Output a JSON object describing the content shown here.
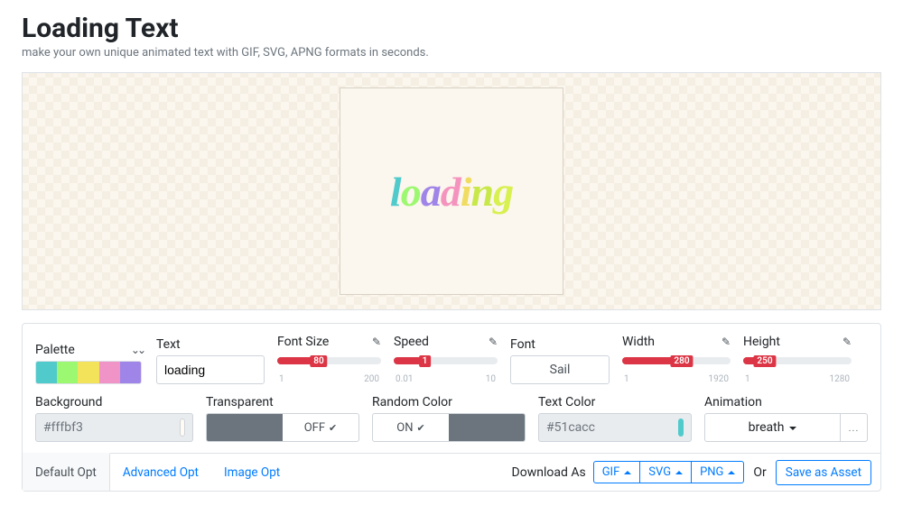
{
  "header": {
    "title": "Loading Text",
    "subtitle": "make your own unique animated text with GIF, SVG, APNG formats in seconds."
  },
  "preview": {
    "text": "loading"
  },
  "palette": {
    "label": "Palette",
    "colors": [
      "#51cacc",
      "#9df871",
      "#f2e35b",
      "#f093c6",
      "#a085e8"
    ]
  },
  "text_field": {
    "label": "Text",
    "value": "loading"
  },
  "font_size": {
    "label": "Font Size",
    "min": "1",
    "max": "200",
    "value": "80",
    "fill_pct": 40
  },
  "speed": {
    "label": "Speed",
    "min": "0.01",
    "max": "10",
    "value": "1",
    "fill_pct": 30
  },
  "font": {
    "label": "Font",
    "value": "Sail"
  },
  "width": {
    "label": "Width",
    "min": "1",
    "max": "1920",
    "value": "280",
    "fill_pct": 55
  },
  "height": {
    "label": "Height",
    "min": "1",
    "max": "1280",
    "value": "250",
    "fill_pct": 20
  },
  "background": {
    "label": "Background",
    "value": "#fffbf3"
  },
  "transparent": {
    "label": "Transparent",
    "state": "OFF"
  },
  "random_color": {
    "label": "Random Color",
    "state": "ON"
  },
  "text_color": {
    "label": "Text Color",
    "value": "#51cacc"
  },
  "animation": {
    "label": "Animation",
    "value": "breath",
    "more": "..."
  },
  "tabs": {
    "default": "Default Opt",
    "advanced": "Advanced Opt",
    "image": "Image Opt"
  },
  "download": {
    "label": "Download As",
    "gif": "GIF",
    "svg": "SVG",
    "png": "PNG",
    "or": "Or",
    "save": "Save as Asset"
  }
}
